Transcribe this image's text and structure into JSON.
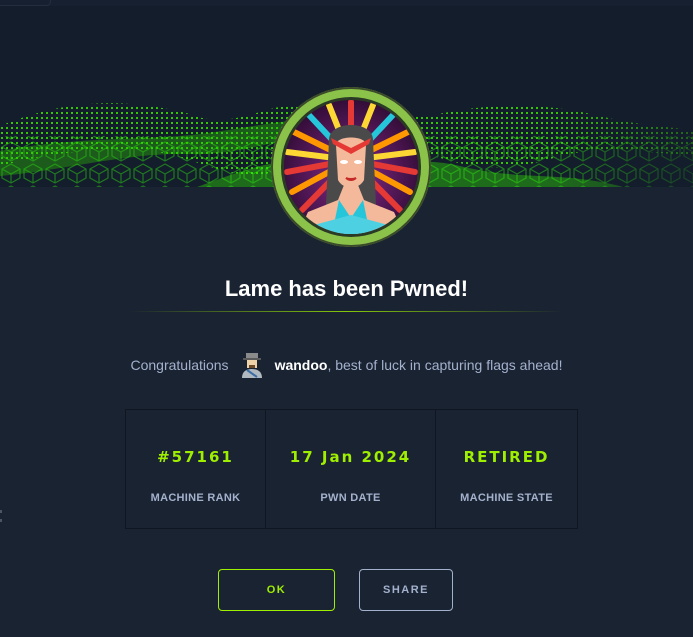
{
  "modal": {
    "title": "Lame has been Pwned!",
    "congrats": {
      "prefix": "Congratulations",
      "username": "wandoo",
      "suffix": ", best of luck in capturing flags ahead!"
    },
    "stats": [
      {
        "value": "#57161",
        "label": "MACHINE RANK"
      },
      {
        "value": "17 Jan 2024",
        "label": "PWN DATE"
      },
      {
        "value": "RETIRED",
        "label": "MACHINE STATE"
      }
    ],
    "buttons": {
      "ok": "OK",
      "share": "SHARE"
    }
  },
  "colors": {
    "accent": "#9fef00",
    "background": "#1a2332",
    "muted_text": "#a4b1cd",
    "avatar_ring": "#8bc34a"
  },
  "icons": {
    "machine_avatar": "machine-avatar-icon",
    "user_avatar": "user-avatar-icon"
  }
}
